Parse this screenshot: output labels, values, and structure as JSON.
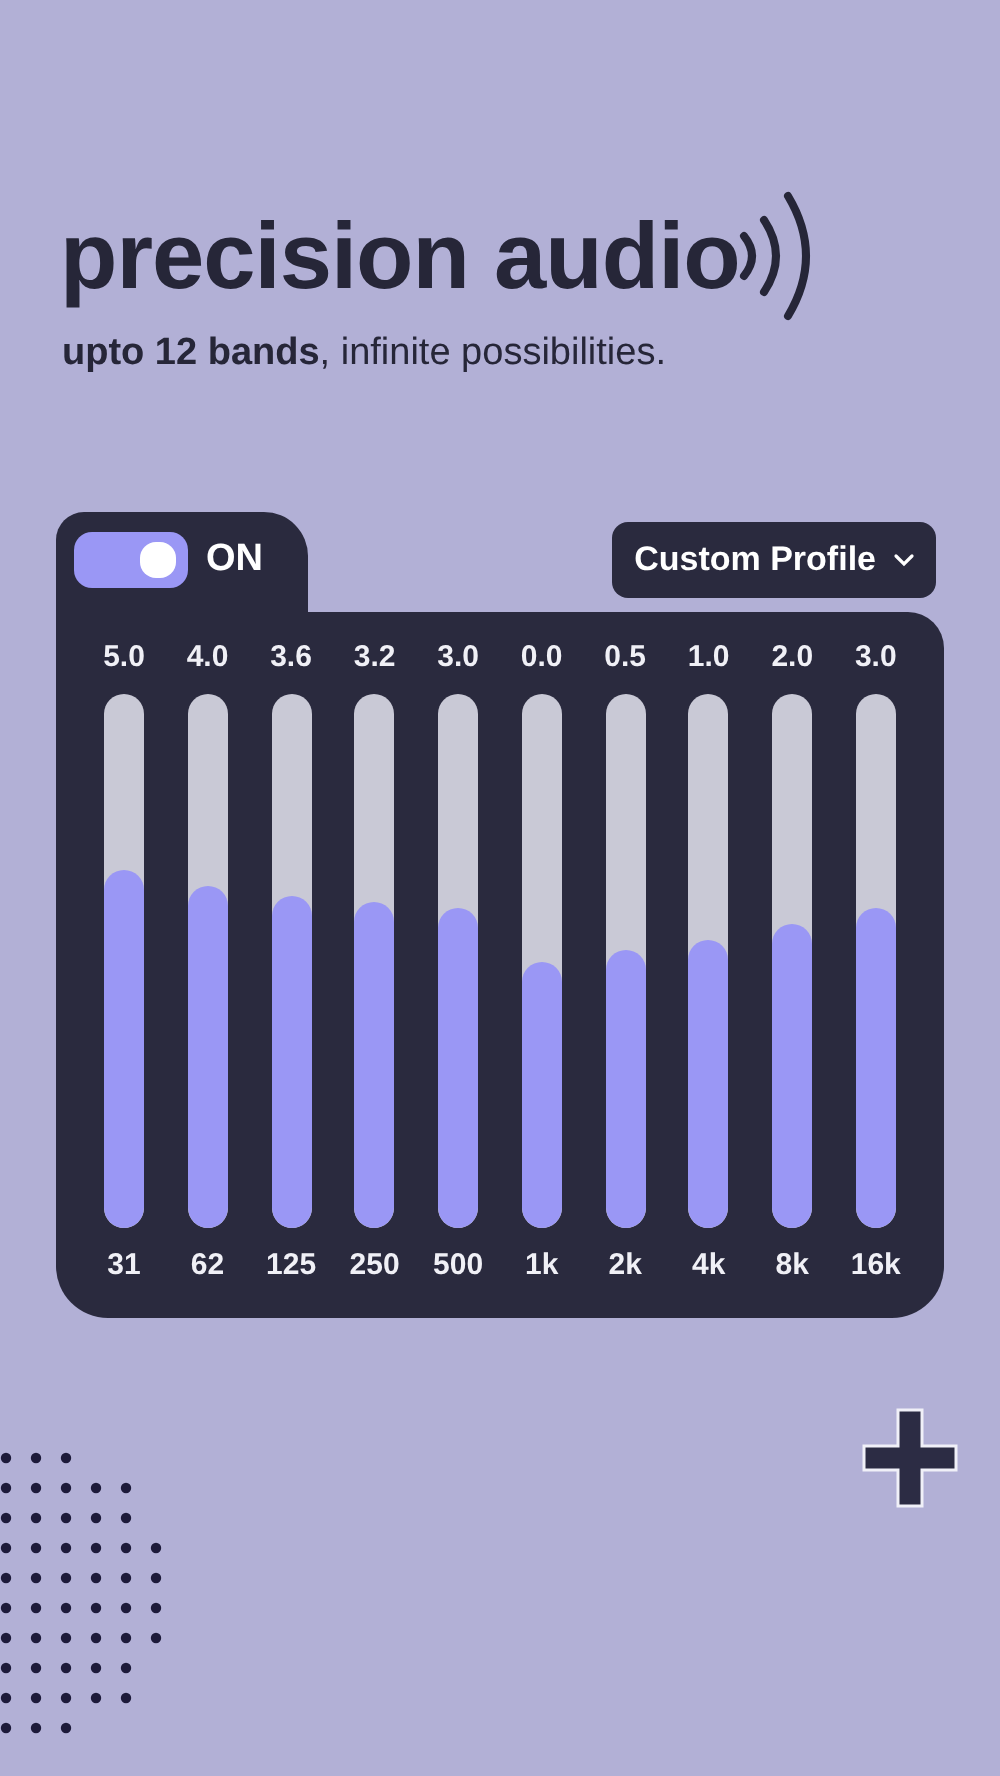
{
  "title": "precision audio",
  "subtitle": "**upto 12 bands**, infinite possibilities.",
  "toggle": {
    "label": "ON",
    "on": true
  },
  "profile": {
    "label": "Custom Profile"
  },
  "bands": [
    {
      "freq": "31",
      "gain": "5.0",
      "level": 0.67
    },
    {
      "freq": "62",
      "gain": "4.0",
      "level": 0.64
    },
    {
      "freq": "125",
      "gain": "3.6",
      "level": 0.62
    },
    {
      "freq": "250",
      "gain": "3.2",
      "level": 0.61
    },
    {
      "freq": "500",
      "gain": "3.0",
      "level": 0.6
    },
    {
      "freq": "1k",
      "gain": "0.0",
      "level": 0.5
    },
    {
      "freq": "2k",
      "gain": "0.5",
      "level": 0.52
    },
    {
      "freq": "4k",
      "gain": "1.0",
      "level": 0.54
    },
    {
      "freq": "8k",
      "gain": "2.0",
      "level": 0.57
    },
    {
      "freq": "16k",
      "gain": "3.0",
      "level": 0.6
    }
  ]
}
